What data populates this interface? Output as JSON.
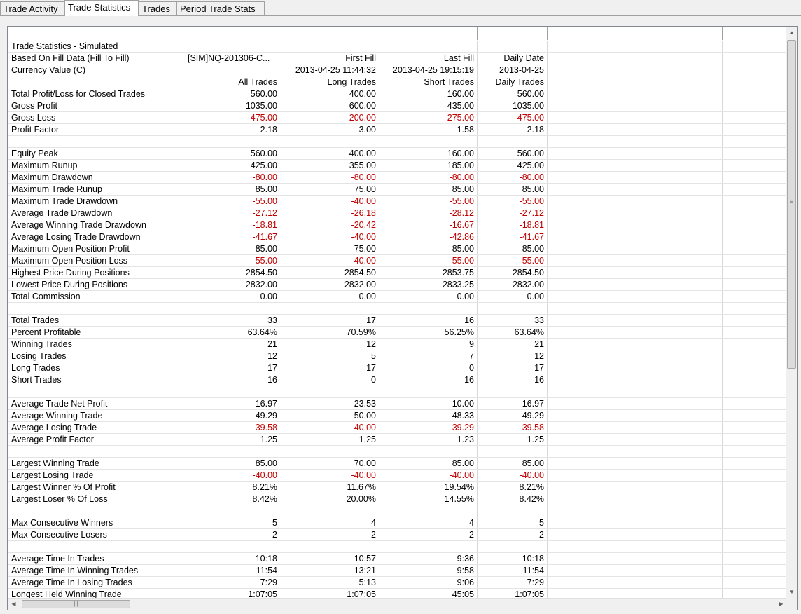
{
  "tabs": [
    "Trade Activity",
    "Trade Statistics",
    "Trades",
    "Period Trade Stats"
  ],
  "colors": {
    "negative": "#c00000",
    "border": "#828790"
  },
  "rows": [
    {
      "label": "Trade Statistics - Simulated",
      "v": [
        "",
        "",
        "",
        ""
      ]
    },
    {
      "label": "Based On Fill Data (Fill To Fill)",
      "v": [
        "[SIM]NQ-201306-C...",
        "First Fill",
        "Last Fill",
        "Daily Date"
      ]
    },
    {
      "label": "Currency Value (C)",
      "v": [
        "",
        "2013-04-25  11:44:32",
        "2013-04-25  19:15:19",
        "2013-04-25"
      ]
    },
    {
      "label": "",
      "v": [
        "All Trades",
        "Long Trades",
        "Short Trades",
        "Daily Trades"
      ]
    },
    {
      "label": "Total Profit/Loss for Closed Trades",
      "v": [
        "560.00",
        "400.00",
        "160.00",
        "560.00"
      ]
    },
    {
      "label": "Gross Profit",
      "v": [
        "1035.00",
        "600.00",
        "435.00",
        "1035.00"
      ]
    },
    {
      "label": "Gross Loss",
      "v": [
        "-475.00",
        "-200.00",
        "-275.00",
        "-475.00"
      ]
    },
    {
      "label": "Profit Factor",
      "v": [
        "2.18",
        "3.00",
        "1.58",
        "2.18"
      ]
    },
    {
      "label": "",
      "v": [
        "",
        "",
        "",
        ""
      ]
    },
    {
      "label": "Equity Peak",
      "v": [
        "560.00",
        "400.00",
        "160.00",
        "560.00"
      ]
    },
    {
      "label": "Maximum Runup",
      "v": [
        "425.00",
        "355.00",
        "185.00",
        "425.00"
      ]
    },
    {
      "label": "Maximum Drawdown",
      "v": [
        "-80.00",
        "-80.00",
        "-80.00",
        "-80.00"
      ]
    },
    {
      "label": "Maximum Trade Runup",
      "v": [
        "85.00",
        "75.00",
        "85.00",
        "85.00"
      ]
    },
    {
      "label": "Maximum Trade Drawdown",
      "v": [
        "-55.00",
        "-40.00",
        "-55.00",
        "-55.00"
      ]
    },
    {
      "label": "Average Trade Drawdown",
      "v": [
        "-27.12",
        "-26.18",
        "-28.12",
        "-27.12"
      ]
    },
    {
      "label": "Average Winning Trade Drawdown",
      "v": [
        "-18.81",
        "-20.42",
        "-16.67",
        "-18.81"
      ]
    },
    {
      "label": "Average Losing Trade Drawdown",
      "v": [
        "-41.67",
        "-40.00",
        "-42.86",
        "-41.67"
      ]
    },
    {
      "label": "Maximum Open Position Profit",
      "v": [
        "85.00",
        "75.00",
        "85.00",
        "85.00"
      ]
    },
    {
      "label": "Maximum Open Position Loss",
      "v": [
        "-55.00",
        "-40.00",
        "-55.00",
        "-55.00"
      ]
    },
    {
      "label": "Highest Price During Positions",
      "v": [
        "2854.50",
        "2854.50",
        "2853.75",
        "2854.50"
      ]
    },
    {
      "label": "Lowest Price During Positions",
      "v": [
        "2832.00",
        "2832.00",
        "2833.25",
        "2832.00"
      ]
    },
    {
      "label": "Total Commission",
      "v": [
        "0.00",
        "0.00",
        "0.00",
        "0.00"
      ]
    },
    {
      "label": "",
      "v": [
        "",
        "",
        "",
        ""
      ]
    },
    {
      "label": "Total Trades",
      "v": [
        "33",
        "17",
        "16",
        "33"
      ]
    },
    {
      "label": "Percent Profitable",
      "v": [
        "63.64%",
        "70.59%",
        "56.25%",
        "63.64%"
      ]
    },
    {
      "label": "Winning Trades",
      "v": [
        "21",
        "12",
        "9",
        "21"
      ]
    },
    {
      "label": "Losing Trades",
      "v": [
        "12",
        "5",
        "7",
        "12"
      ]
    },
    {
      "label": "Long Trades",
      "v": [
        "17",
        "17",
        "0",
        "17"
      ]
    },
    {
      "label": "Short Trades",
      "v": [
        "16",
        "0",
        "16",
        "16"
      ]
    },
    {
      "label": "",
      "v": [
        "",
        "",
        "",
        ""
      ]
    },
    {
      "label": "Average Trade Net Profit",
      "v": [
        "16.97",
        "23.53",
        "10.00",
        "16.97"
      ]
    },
    {
      "label": "Average Winning Trade",
      "v": [
        "49.29",
        "50.00",
        "48.33",
        "49.29"
      ]
    },
    {
      "label": "Average Losing Trade",
      "v": [
        "-39.58",
        "-40.00",
        "-39.29",
        "-39.58"
      ]
    },
    {
      "label": "Average Profit Factor",
      "v": [
        "1.25",
        "1.25",
        "1.23",
        "1.25"
      ]
    },
    {
      "label": "",
      "v": [
        "",
        "",
        "",
        ""
      ]
    },
    {
      "label": "Largest Winning Trade",
      "v": [
        "85.00",
        "70.00",
        "85.00",
        "85.00"
      ]
    },
    {
      "label": "Largest Losing Trade",
      "v": [
        "-40.00",
        "-40.00",
        "-40.00",
        "-40.00"
      ]
    },
    {
      "label": "Largest Winner % Of Profit",
      "v": [
        "8.21%",
        "11.67%",
        "19.54%",
        "8.21%"
      ]
    },
    {
      "label": "Largest Loser % Of Loss",
      "v": [
        "8.42%",
        "20.00%",
        "14.55%",
        "8.42%"
      ]
    },
    {
      "label": "",
      "v": [
        "",
        "",
        "",
        ""
      ]
    },
    {
      "label": "Max Consecutive Winners",
      "v": [
        "5",
        "4",
        "4",
        "5"
      ]
    },
    {
      "label": "Max Consecutive Losers",
      "v": [
        "2",
        "2",
        "2",
        "2"
      ]
    },
    {
      "label": "",
      "v": [
        "",
        "",
        "",
        ""
      ]
    },
    {
      "label": "Average Time In Trades",
      "v": [
        "10:18",
        "10:57",
        "9:36",
        "10:18"
      ]
    },
    {
      "label": "Average Time In Winning Trades",
      "v": [
        "11:54",
        "13:21",
        "9:58",
        "11:54"
      ]
    },
    {
      "label": "Average Time In Losing Trades",
      "v": [
        "7:29",
        "5:13",
        "9:06",
        "7:29"
      ]
    },
    {
      "label": "Longest Held Winning Trade",
      "v": [
        "1:07:05",
        "1:07:05",
        "45:05",
        "1:07:05"
      ]
    }
  ]
}
